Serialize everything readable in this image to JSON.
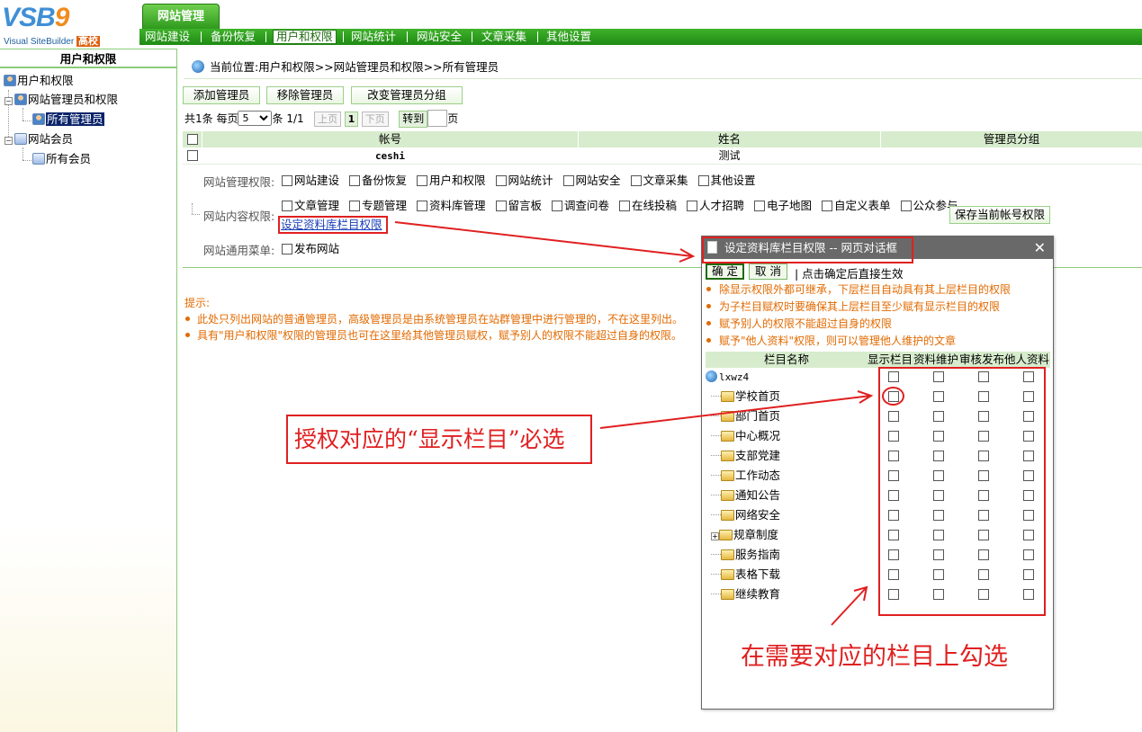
{
  "header": {
    "logo_text": "VSB",
    "logo_nine": "9",
    "logo_sub": "Visual SiteBuilder",
    "logo_badge": "高校",
    "main_tab": "网站管理",
    "nav": [
      "网站建设",
      "备份恢复",
      "用户和权限",
      "网站统计",
      "网站安全",
      "文章采集",
      "其他设置"
    ],
    "nav_active": "用户和权限"
  },
  "sidebar": {
    "title": "用户和权限",
    "tree": {
      "root": "用户和权限",
      "admins": "网站管理员和权限",
      "all_admins": "所有管理员",
      "members": "网站会员",
      "all_members": "所有会员"
    }
  },
  "breadcrumb": {
    "label": "当前位置:",
    "path": "用户和权限>>网站管理员和权限>>所有管理员"
  },
  "toolbar": {
    "add": "添加管理员",
    "remove": "移除管理员",
    "change_group": "改变管理员分组"
  },
  "pager": {
    "total": "共1条",
    "per_page_label": "每页",
    "per_page": "5",
    "unit": "条",
    "pages": "1/1",
    "prev": "上页",
    "current": "1",
    "next": "下页",
    "goto": "转到",
    "page_suffix": "页"
  },
  "table": {
    "headers": [
      "帐号",
      "姓名",
      "管理员分组"
    ],
    "rows": [
      {
        "account": "ceshi",
        "name": "测试",
        "group": ""
      }
    ]
  },
  "permissions": {
    "site_label": "网站管理权限:",
    "site_items": [
      "网站建设",
      "备份恢复",
      "用户和权限",
      "网站统计",
      "网站安全",
      "文章采集",
      "其他设置"
    ],
    "content_label": "网站内容权限:",
    "content_items": [
      "文章管理",
      "专题管理",
      "资料库管理",
      "留言板",
      "调查问卷",
      "在线投稿",
      "人才招聘",
      "电子地图",
      "自定义表单",
      "公众参与"
    ],
    "set_link": "设定资料库栏目权限",
    "save_button": "保存当前帐号权限",
    "common_label": "网站通用菜单:",
    "common_items": [
      "发布网站"
    ]
  },
  "tips": {
    "title": "提示:",
    "items": [
      "此处只列出网站的普通管理员，高级管理员是由系统管理员在站群管理中进行管理的，不在这里列出。",
      "具有\"用户和权限\"权限的管理员也可在这里给其他管理员赋权，赋予别人的权限不能超过自身的权限。"
    ]
  },
  "dialog": {
    "title": "设定资料库栏目权限 -- 网页对话框",
    "close": "✕",
    "ok": "确 定",
    "cancel": "取 消",
    "note": "| 点击确定后直接生效",
    "tips": [
      "除显示权限外都可继承，下层栏目自动具有其上层栏目的权限",
      "为子栏目赋权时要确保其上层栏目至少赋有显示栏目的权限",
      "赋予别人的权限不能超过自身的权限",
      "赋予\"他人资料\"权限，则可以管理他人维护的文章"
    ],
    "columns": [
      "栏目名称",
      "显示栏目",
      "资料维护",
      "审核发布",
      "他人资料"
    ],
    "root": "lxwz4",
    "rows": [
      "学校首页",
      "部门首页",
      "中心概况",
      "支部党建",
      "工作动态",
      "通知公告",
      "网络安全",
      "规章制度",
      "服务指南",
      "表格下载",
      "继续教育"
    ]
  },
  "annotations": {
    "note1": "授权对应的“显示栏目”必选",
    "note2": "在需要对应的栏目上勾选"
  },
  "colors": {
    "nav_green": "#2f9a1e",
    "header_row": "#d7eccd",
    "annotation_red": "#e02020",
    "tip_orange": "#e26a00"
  }
}
